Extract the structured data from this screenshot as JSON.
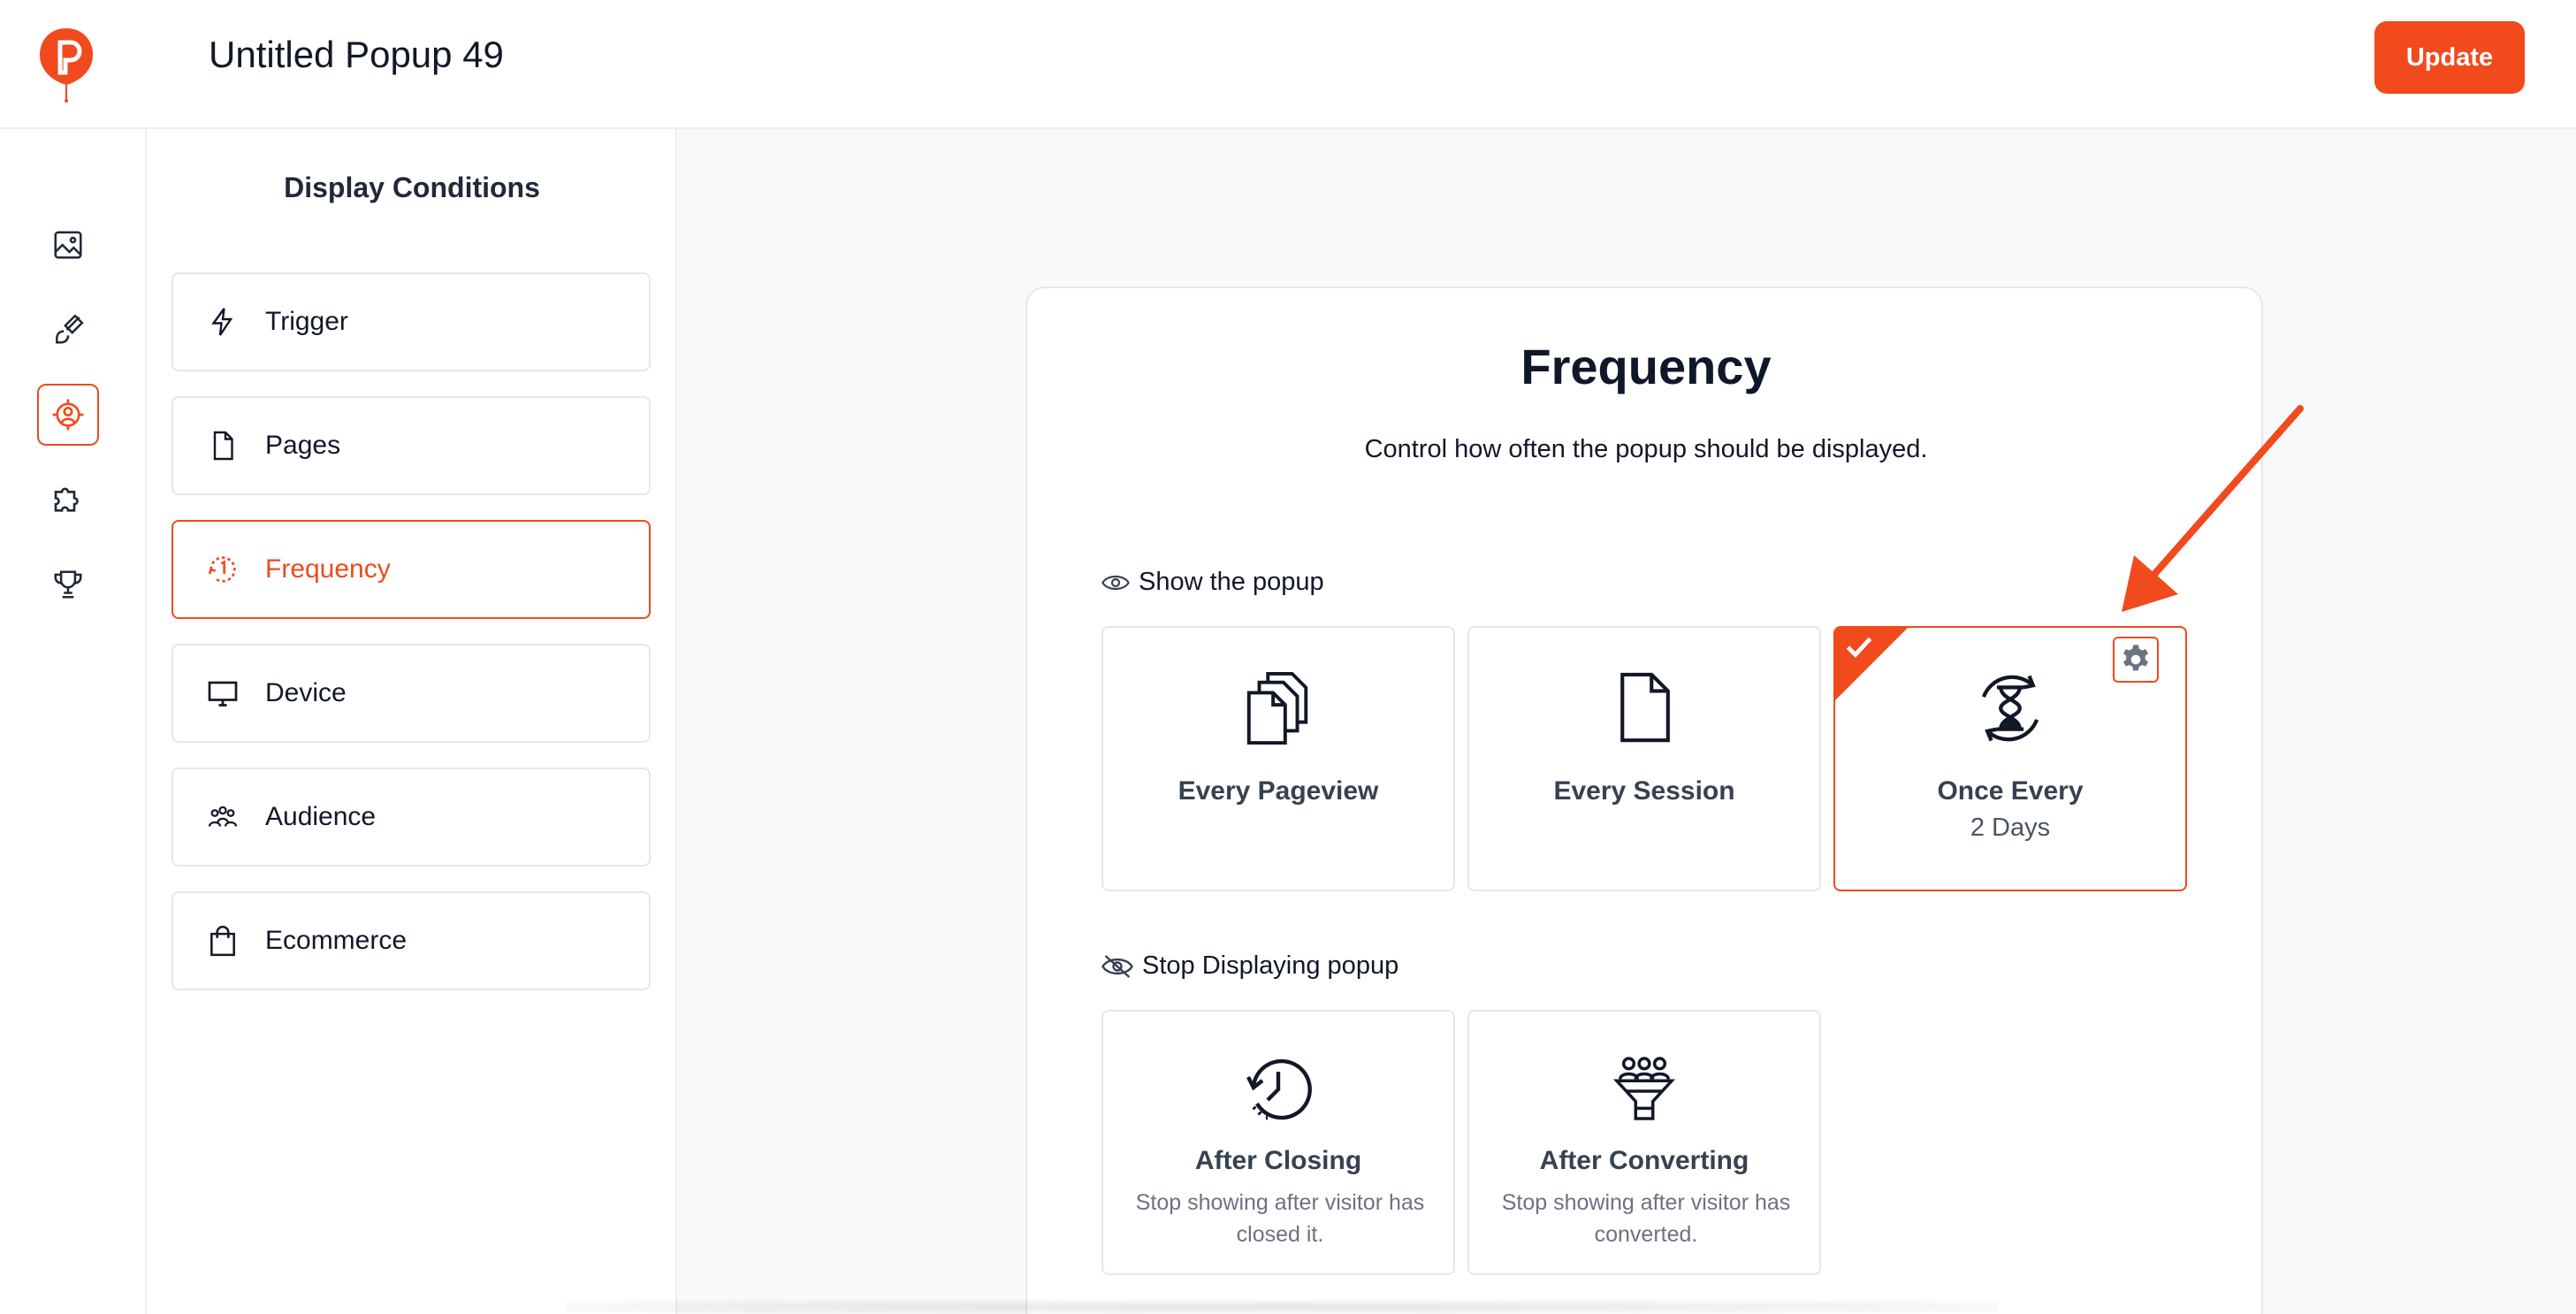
{
  "header": {
    "popup_title": "Untitled Popup 49",
    "update_label": "Update"
  },
  "rail": {
    "items": [
      {
        "icon": "image-icon",
        "active": false
      },
      {
        "icon": "brush-icon",
        "active": false
      },
      {
        "icon": "target-icon",
        "active": true
      },
      {
        "icon": "puzzle-icon",
        "active": false
      },
      {
        "icon": "trophy-icon",
        "active": false
      }
    ]
  },
  "panel": {
    "title": "Display Conditions",
    "items": [
      {
        "label": "Trigger",
        "icon": "lightning-icon"
      },
      {
        "label": "Pages",
        "icon": "page-icon"
      },
      {
        "label": "Frequency",
        "icon": "clock-icon",
        "active": true
      },
      {
        "label": "Device",
        "icon": "monitor-icon"
      },
      {
        "label": "Audience",
        "icon": "users-icon"
      },
      {
        "label": "Ecommerce",
        "icon": "shopping-bag-icon"
      }
    ]
  },
  "main": {
    "title": "Frequency",
    "description": "Control how often the popup should be displayed.",
    "show_label": "Show the popup",
    "show_options": [
      {
        "title": "Every Pageview",
        "icon": "pages-stack-icon"
      },
      {
        "title": "Every Session",
        "icon": "file-icon"
      },
      {
        "title": "Once Every",
        "subtitle": "2 Days",
        "icon": "hourglass-icon",
        "selected": true
      }
    ],
    "stop_label": "Stop Displaying popup",
    "stop_options": [
      {
        "title": "After Closing",
        "description": "Stop showing after visitor has closed it.",
        "icon": "history-icon"
      },
      {
        "title": "After Converting",
        "description": "Stop showing after visitor has converted.",
        "icon": "funnel-icon"
      }
    ]
  },
  "colors": {
    "accent": "#f04a1d",
    "border": "#e5e7eb",
    "background": "#f8f9fb"
  }
}
